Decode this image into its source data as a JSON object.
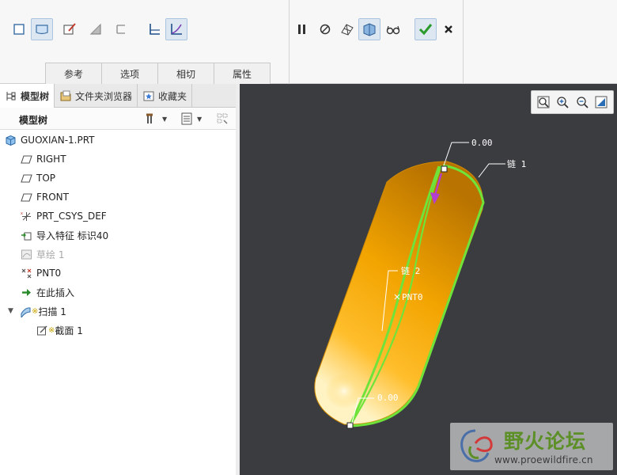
{
  "ribbon": {
    "tabs": [
      "参考",
      "选项",
      "相切",
      "属性"
    ]
  },
  "left_panel": {
    "tabs": [
      {
        "label": "模型树",
        "icon": "model-tree-icon"
      },
      {
        "label": "文件夹浏览器",
        "icon": "folder-browser-icon"
      },
      {
        "label": "收藏夹",
        "icon": "favorites-icon"
      }
    ],
    "tree_title": "模型树"
  },
  "tree": {
    "root": "GUOXIAN-1.PRT",
    "items": [
      {
        "label": "RIGHT",
        "icon": "datum-plane-icon"
      },
      {
        "label": "TOP",
        "icon": "datum-plane-icon"
      },
      {
        "label": "FRONT",
        "icon": "datum-plane-icon"
      },
      {
        "label": "PRT_CSYS_DEF",
        "icon": "csys-icon"
      },
      {
        "label": "导入特征 标识40",
        "icon": "import-feature-icon"
      },
      {
        "label": "草绘 1",
        "icon": "sketch-icon"
      },
      {
        "label": "PNT0",
        "icon": "datum-point-icon"
      },
      {
        "label": "在此插入",
        "icon": "insert-here-arrow-icon"
      },
      {
        "label": "扫描 1",
        "icon": "sweep-icon"
      },
      {
        "label": "截面 1",
        "icon": "section-sketch-icon"
      }
    ]
  },
  "viewport": {
    "labels": {
      "dim_top": "0.00",
      "dim_bottom": "0.00",
      "chain_1": "链 1",
      "chain_2": "链 2",
      "point": "PNT0"
    }
  },
  "watermark": {
    "title": "野火论坛",
    "url": "www.proewildfire.cn"
  },
  "colors": {
    "background": "#3b3c40",
    "body": "#f2a400",
    "trajectory": "#6fe33a",
    "direction_arrow": "#b23fd1",
    "confirm": "#2a9a2a"
  }
}
